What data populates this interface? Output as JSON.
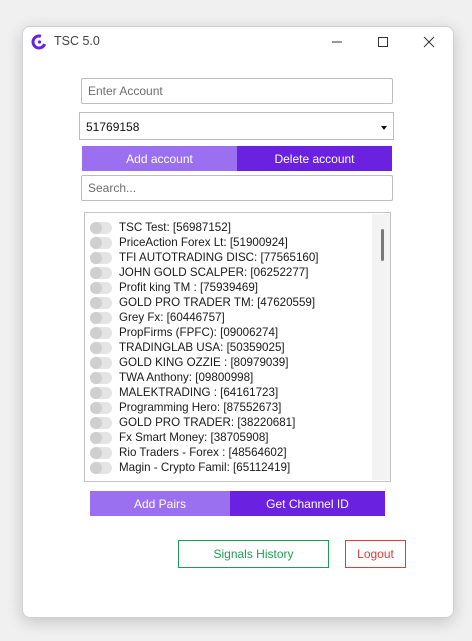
{
  "window": {
    "title": "TSC 5.0"
  },
  "account_input": {
    "placeholder": "Enter Account"
  },
  "account_select": {
    "value": "51769158"
  },
  "account_buttons": {
    "add_label": "Add account",
    "delete_label": "Delete account"
  },
  "search": {
    "placeholder": "Search..."
  },
  "channels": [
    {
      "label": "TSC Test: [56987152]",
      "enabled": false
    },
    {
      "label": "PriceAction Forex Lt: [51900924]",
      "enabled": false
    },
    {
      "label": "TFI AUTOTRADING DISC: [77565160]",
      "enabled": false
    },
    {
      "label": "JOHN GOLD SCALPER: [06252277]",
      "enabled": false
    },
    {
      "label": "Profit king TM : [75939469]",
      "enabled": false
    },
    {
      "label": "GOLD PRO TRADER TM: [47620559]",
      "enabled": false
    },
    {
      "label": "Grey Fx: [60446757]",
      "enabled": false
    },
    {
      "label": "PropFirms (FPFC): [09006274]",
      "enabled": false
    },
    {
      "label": "TRADINGLAB USA: [50359025]",
      "enabled": false
    },
    {
      "label": "GOLD KING OZZIE : [80979039]",
      "enabled": false
    },
    {
      "label": "TWA Anthony: [09800998]",
      "enabled": false
    },
    {
      "label": "MALEKTRADING : [64161723]",
      "enabled": false
    },
    {
      "label": "Programming Hero: [87552673]",
      "enabled": false
    },
    {
      "label": "GOLD PRO TRADER: [38220681]",
      "enabled": false
    },
    {
      "label": "Fx Smart Money: [38705908]",
      "enabled": false
    },
    {
      "label": "Rio Traders - Forex : [48564602]",
      "enabled": false
    },
    {
      "label": "Magin - Crypto Famil: [65112419]",
      "enabled": false
    }
  ],
  "pair_buttons": {
    "add_pairs_label": "Add Pairs",
    "get_channel_id_label": "Get Channel ID"
  },
  "footer": {
    "signals_history_label": "Signals History",
    "logout_label": "Logout"
  },
  "colors": {
    "accent_light": "#9a6ff0",
    "accent_dark": "#6a22e0",
    "signals_green": "#1f9d55",
    "logout_red": "#e03a3a"
  }
}
